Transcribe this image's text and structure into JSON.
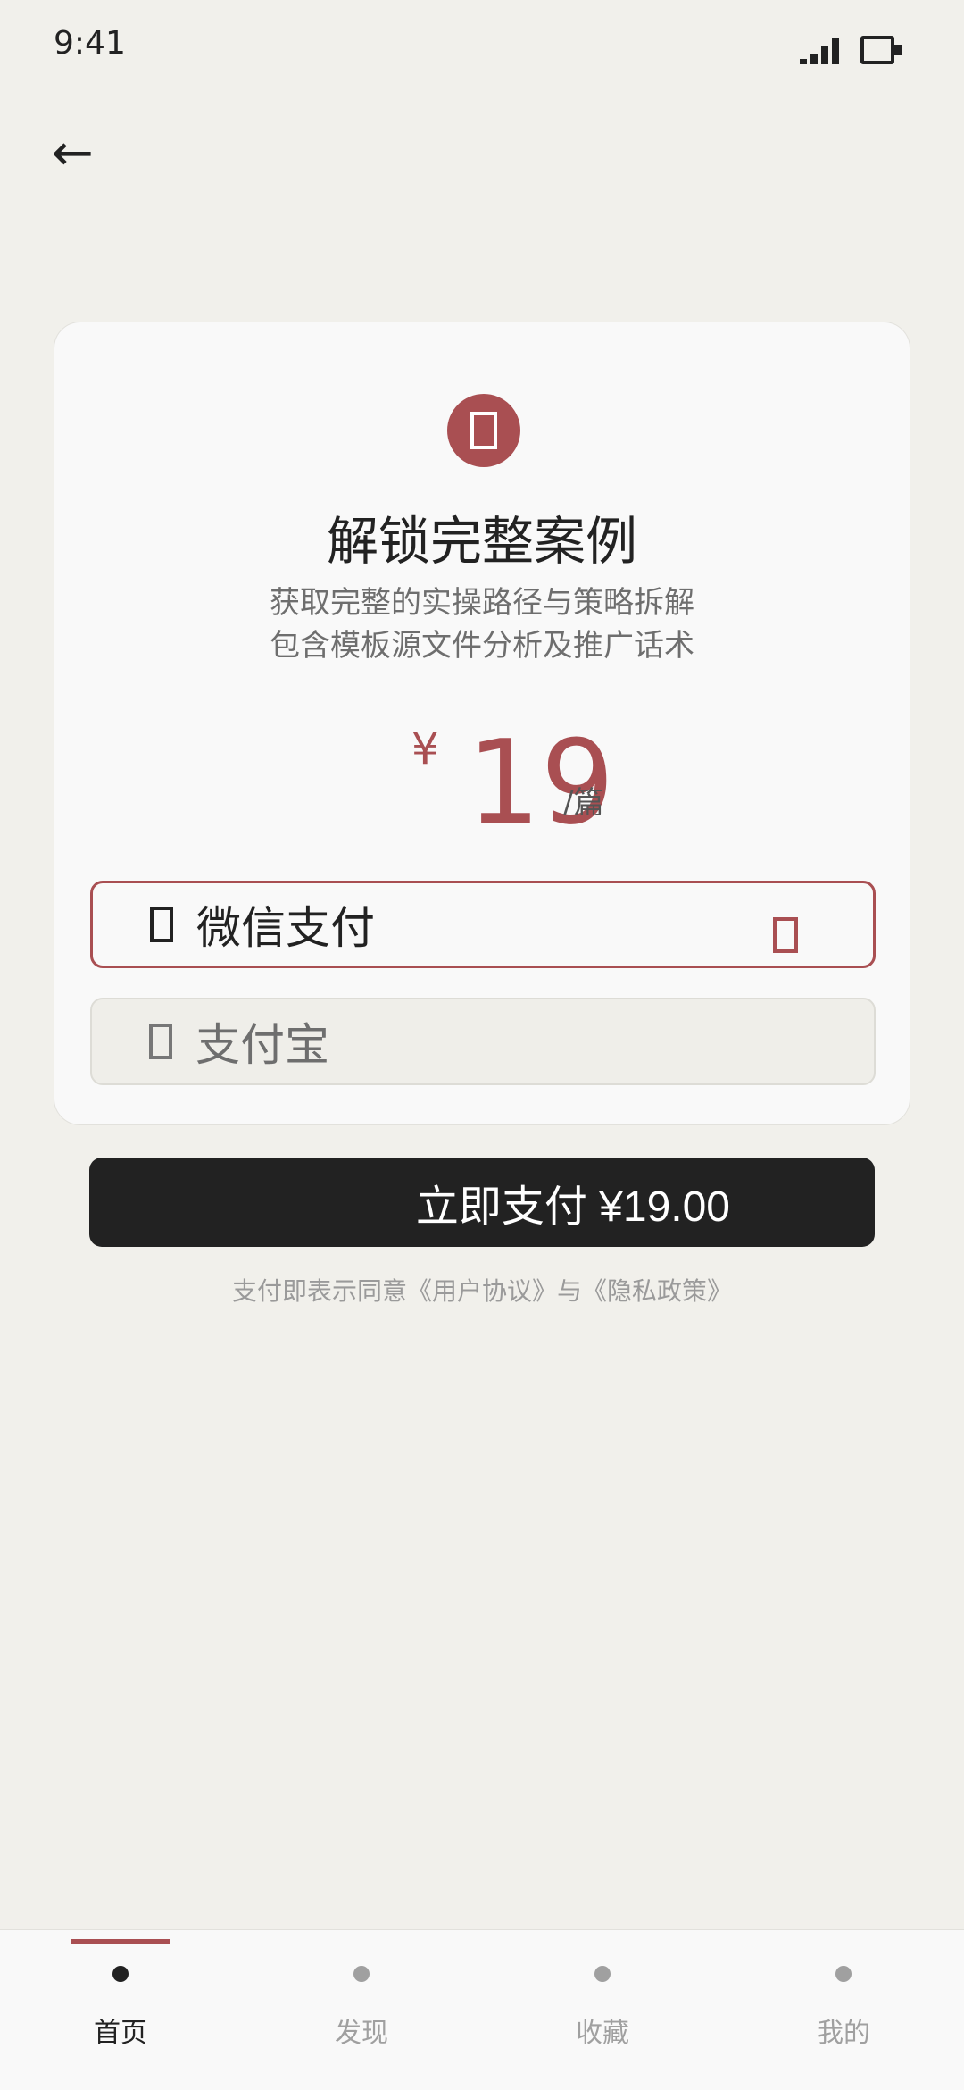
{
  "status_bar": {
    "time": "9:41"
  },
  "header": {
    "back_icon": "←"
  },
  "unlock_card": {
    "badge_icon": "lock-icon",
    "title": "解锁完整案例",
    "description_line1": "获取完整的实操路径与策略拆解",
    "description_line2": "包含模板源文件分析及推广话术",
    "price_symbol": "¥",
    "price_value": "19",
    "price_unit": "/篇",
    "payment_options": [
      {
        "label": "微信支付",
        "selected": true
      },
      {
        "label": "支付宝",
        "selected": false
      }
    ]
  },
  "pay_button": {
    "label": "立即支付 ¥19.00"
  },
  "agreement": {
    "prefix": "支付即表示同意",
    "user_agreement": "《用户协议》",
    "and": "与",
    "privacy_policy": "《隐私政策》"
  },
  "tabbar": {
    "items": [
      {
        "label": "首页",
        "active": true
      },
      {
        "label": "发现",
        "active": false
      },
      {
        "label": "收藏",
        "active": false
      },
      {
        "label": "我的",
        "active": false
      }
    ]
  },
  "colors": {
    "accent": "#A94F52",
    "background": "#F1F0EB",
    "card": "#F9F9F9",
    "button": "#222222"
  }
}
